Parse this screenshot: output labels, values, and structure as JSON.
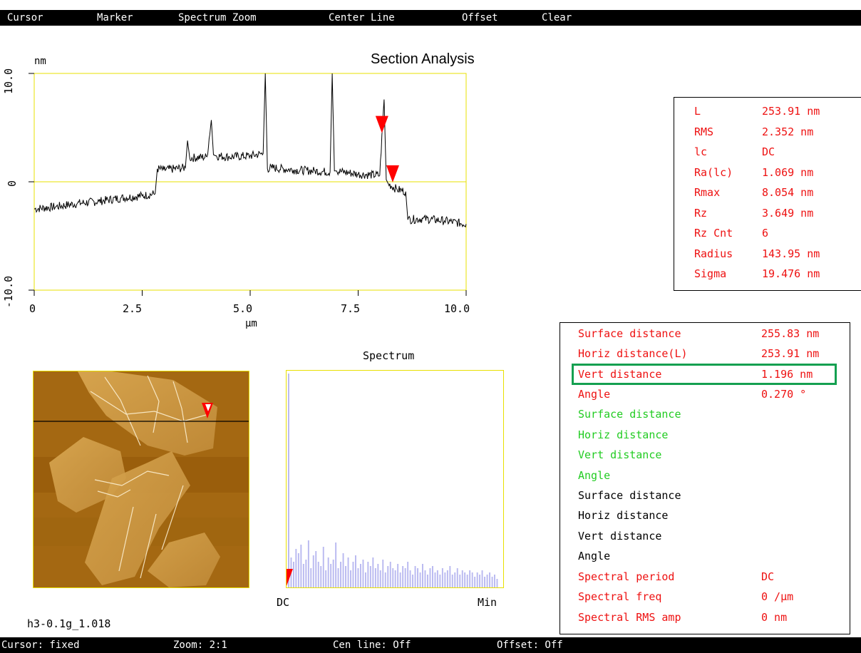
{
  "menu": {
    "items": [
      "Cursor",
      "Marker",
      "Spectrum Zoom",
      "Center Line",
      "Offset",
      "Clear"
    ]
  },
  "section": {
    "title": "Section Analysis",
    "y_unit": "nm",
    "x_unit": "μm",
    "y_ticks": [
      "10.0",
      "0",
      "-10.0"
    ],
    "x_ticks": [
      "0",
      "2.5",
      "5.0",
      "7.5",
      "10.0"
    ]
  },
  "chart_data": [
    {
      "type": "line",
      "title": "Section Analysis",
      "xlabel": "μm",
      "ylabel": "nm",
      "xlim": [
        0,
        10
      ],
      "ylim": [
        -10,
        10
      ],
      "center_line_y": 0,
      "x": [
        0,
        0.5,
        1.0,
        1.5,
        2.0,
        2.5,
        2.8,
        2.85,
        3.0,
        3.5,
        3.55,
        3.6,
        4.0,
        4.1,
        4.15,
        4.2,
        4.5,
        5.0,
        5.3,
        5.35,
        5.4,
        5.5,
        6.0,
        6.5,
        6.85,
        6.9,
        6.95,
        7.0,
        7.5,
        8.0,
        8.1,
        8.15,
        8.2,
        8.4,
        8.6,
        8.65,
        9.0,
        9.5,
        10.0
      ],
      "y": [
        -2.5,
        -2.3,
        -2.0,
        -1.8,
        -1.5,
        -1.3,
        -1.1,
        1.2,
        1.1,
        1.3,
        3.8,
        2.2,
        2.3,
        5.7,
        2.5,
        2.4,
        2.3,
        2.4,
        2.6,
        10.0,
        1.2,
        1.3,
        1.1,
        1.0,
        0.9,
        10.0,
        1.0,
        1.0,
        0.7,
        0.6,
        7.6,
        0.2,
        -0.2,
        -0.7,
        -0.9,
        -3.5,
        -3.4,
        -3.6,
        -3.9
      ],
      "markers_x": [
        8.05,
        8.3
      ]
    },
    {
      "type": "bar",
      "title": "Spectrum",
      "x_labels": [
        "DC",
        "Min"
      ],
      "values": [
        100,
        14,
        12,
        18,
        16,
        20,
        11,
        13,
        22,
        9,
        15,
        17,
        12,
        10,
        19,
        8,
        14,
        11,
        13,
        21,
        9,
        12,
        16,
        10,
        14,
        8,
        12,
        15,
        9,
        11,
        13,
        7,
        12,
        10,
        14,
        9,
        11,
        8,
        13,
        7,
        10,
        12,
        9,
        8,
        11,
        7,
        10,
        9,
        12,
        8,
        6,
        10,
        9,
        7,
        11,
        8,
        6,
        9,
        10,
        7,
        8,
        6,
        9,
        7,
        8,
        10,
        6,
        7,
        9,
        6,
        8,
        7,
        6,
        8,
        7,
        5,
        7,
        6,
        8,
        5,
        6,
        7,
        5,
        6,
        4
      ]
    }
  ],
  "stats_box": {
    "rows": [
      {
        "label": "L",
        "value": "253.91 nm"
      },
      {
        "label": "RMS",
        "value": "2.352 nm"
      },
      {
        "label": "lc",
        "value": "DC"
      },
      {
        "label": "Ra(lc)",
        "value": "1.069 nm"
      },
      {
        "label": "Rmax",
        "value": "8.054 nm"
      },
      {
        "label": "Rz",
        "value": "3.649 nm"
      },
      {
        "label": "Rz Cnt",
        "value": "6"
      },
      {
        "label": "Radius",
        "value": "143.95 nm"
      },
      {
        "label": "Sigma",
        "value": "19.476 nm"
      }
    ]
  },
  "spectrum": {
    "title": "Spectrum",
    "left_label": "DC",
    "right_label": "Min"
  },
  "image": {
    "filename": "h3-0.1g_1.018"
  },
  "measure_box": {
    "red_rows": [
      {
        "label": "Surface distance",
        "value": "255.83 nm"
      },
      {
        "label": "Horiz distance(L)",
        "value": "253.91 nm"
      },
      {
        "label": "Vert distance",
        "value": "1.196 nm"
      },
      {
        "label": "Angle",
        "value": "0.270 °"
      }
    ],
    "green_rows": [
      {
        "label": "Surface distance"
      },
      {
        "label": "Horiz distance"
      },
      {
        "label": "Vert distance"
      },
      {
        "label": "Angle"
      }
    ],
    "black_rows": [
      {
        "label": "Surface distance"
      },
      {
        "label": "Horiz distance"
      },
      {
        "label": "Vert distance"
      },
      {
        "label": "Angle"
      }
    ],
    "spectral_rows": [
      {
        "label": "Spectral period",
        "value": "DC"
      },
      {
        "label": "Spectral freq",
        "value": "0 /μm"
      },
      {
        "label": "Spectral RMS amp",
        "value": "0 nm"
      }
    ]
  },
  "status": {
    "cursor": "Cursor: fixed",
    "zoom": "Zoom: 2:1",
    "cen_line": "Cen line: Off",
    "offset": "Offset: Off"
  },
  "colors": {
    "axis_frame": "#e8e000",
    "marker": "#ff0000",
    "highlight": "#14a050",
    "spectrum_bar": "#b8b8f0"
  }
}
